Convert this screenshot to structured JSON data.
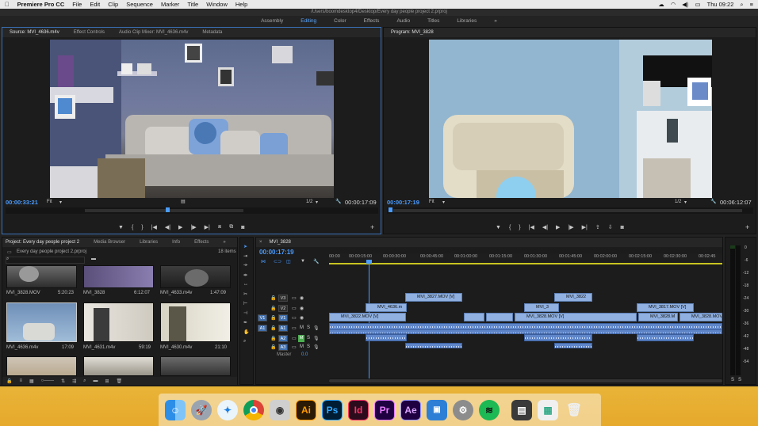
{
  "menubar": {
    "app": "Premiere Pro CC",
    "items": [
      "File",
      "Edit",
      "Clip",
      "Sequence",
      "Marker",
      "Title",
      "Window",
      "Help"
    ],
    "clock": "Thu 09:22"
  },
  "titlebar": {
    "path": "/Users/boomdesktop4/Desktop/Every day people project 2.prproj"
  },
  "workspaces": {
    "items": [
      "Assembly",
      "Editing",
      "Color",
      "Effects",
      "Audio",
      "Titles",
      "Libraries"
    ],
    "active": "Editing",
    "more": "»"
  },
  "source": {
    "tabs": [
      "Source: MVI_4636.m4v",
      "Effect Controls",
      "Audio Clip Mixer: MVI_4636.m4v",
      "Metadata"
    ],
    "timecode": "00:00:33:21",
    "duration": "00:00:17:09",
    "fit": "Fit",
    "resolution": "1/2",
    "add": "+"
  },
  "program": {
    "tab": "Program: MVI_3828",
    "timecode": "00:00:17:19",
    "duration": "00:06:12:07",
    "fit": "Fit",
    "resolution": "1/2",
    "add": "+"
  },
  "project": {
    "tabs": [
      "Project: Every day people project 2",
      "Media Browser",
      "Libraries",
      "Info",
      "Effects"
    ],
    "more": "»",
    "file": "Every day people project 2.prproj",
    "count": "18 items",
    "items": [
      {
        "name": "MVI_3828.MOV",
        "dur": "5:20:23"
      },
      {
        "name": "MVI_3828",
        "dur": "6:12:07"
      },
      {
        "name": "MVI_4633.m4v",
        "dur": "1:47:09"
      },
      {
        "name": "MVI_4636.m4v",
        "dur": "17:09"
      },
      {
        "name": "MVI_4631.m4v",
        "dur": "59:19"
      },
      {
        "name": "MVI_4630.m4v",
        "dur": "21:10"
      },
      {
        "name": "",
        "dur": ""
      },
      {
        "name": "",
        "dur": ""
      },
      {
        "name": "",
        "dur": ""
      }
    ]
  },
  "timeline": {
    "tab": "MVI_3828",
    "timecode": "00:00:17:19",
    "ruler": [
      "00:00",
      "00:00:15:00",
      "00:00:30:00",
      "00:00:45:00",
      "00:01:00:00",
      "00:01:15:00",
      "00:01:30:00",
      "00:01:45:00",
      "00:02:00:00",
      "00:02:15:00",
      "00:02:30:00",
      "00:02:45"
    ],
    "tracks": {
      "v3": "V3",
      "v2": "V2",
      "v1": "V1",
      "a1": "A1",
      "a2": "A2",
      "a3": "A3",
      "src_v": "V1",
      "src_a": "A1",
      "m": "M",
      "s": "S",
      "master": "Master",
      "master_val": "0.0"
    },
    "clips": {
      "v1a": "MVI_3822.MOV [V]",
      "v1b": "MVI_3828.MOV [V]",
      "v1c": "MVI_3828.M",
      "v1d": "MVI_3828.MOV",
      "v2a": "MVI_4636.m",
      "v2b": "MVI_3",
      "v2c": "MVI_3817.MOV [V]",
      "v3a": "MVI_3827.MOV [V]",
      "v3b": "MVI_3822"
    }
  },
  "meter": {
    "labels": [
      "0",
      "-6",
      "-12",
      "-18",
      "-24",
      "-30",
      "-36",
      "-42",
      "-48",
      "-54"
    ],
    "bottom": [
      "S",
      "S"
    ]
  },
  "dock": {
    "apps": [
      "finder",
      "launchpad",
      "safari",
      "chrome",
      "photos",
      "Ai",
      "Ps",
      "Id",
      "Pr",
      "Ae",
      "keynote",
      "settings",
      "spotify",
      "image",
      "preview",
      "trash"
    ]
  },
  "colors": {
    "accent": "#4a9cff",
    "clip_video": "#8fb0e0",
    "clip_audio": "#5f86c9",
    "dock_bg": "#e8b438"
  }
}
